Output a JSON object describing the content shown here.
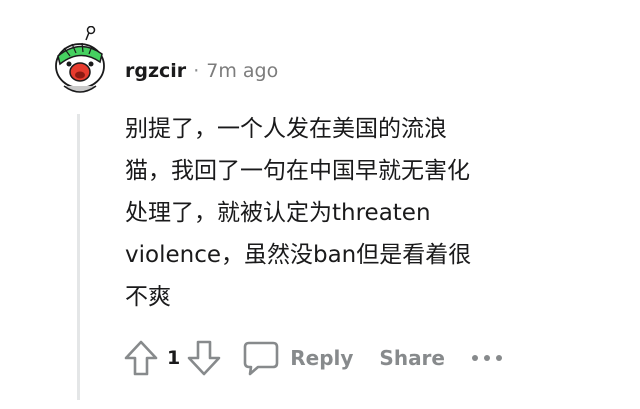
{
  "comment": {
    "author": "rgzcir",
    "separator": "·",
    "timestamp": "7m ago",
    "body_lines": [
      "别提了，一个人发在美国的流浪",
      "猫，我回了一句在中国早就无害化",
      "处理了，就被认定为threaten",
      "violence，虽然没ban但是看着很",
      "不爽"
    ],
    "score": "1",
    "actions": {
      "reply_label": "Reply",
      "share_label": "Share"
    }
  },
  "icons": {
    "avatar": "snoo-avatar-green-headband",
    "upvote": "upvote-arrow-icon",
    "downvote": "downvote-arrow-icon",
    "reply": "speech-bubble-icon",
    "more": "more-horizontal-icon"
  },
  "colors": {
    "text": "#1a1a1b",
    "meta": "#7c7c7c",
    "action": "#878a8c",
    "thread_line": "#e4e6e7",
    "avatar_accent": "#46d160"
  }
}
